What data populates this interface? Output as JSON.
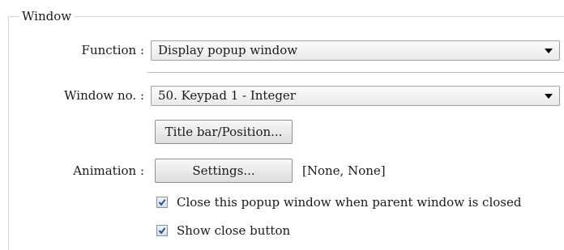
{
  "group": {
    "title": "Window"
  },
  "function": {
    "label": "Function :",
    "value": "Display popup window"
  },
  "window_no": {
    "label": "Window no. :",
    "value": "50. Keypad 1 - Integer",
    "title_bar_button": "Title bar/Position..."
  },
  "animation": {
    "label": "Animation :",
    "settings_button": "Settings...",
    "value_text": "[None, None]"
  },
  "options": [
    {
      "label": "Close this popup window when parent window is closed",
      "checked": true
    },
    {
      "label": "Show close button",
      "checked": true
    }
  ],
  "colors": {
    "checkmark": "#2a4f8f",
    "group_border": "#d6d6d6"
  },
  "icons": {
    "dropdown": "chevron-down-icon",
    "check": "checkmark-icon"
  }
}
